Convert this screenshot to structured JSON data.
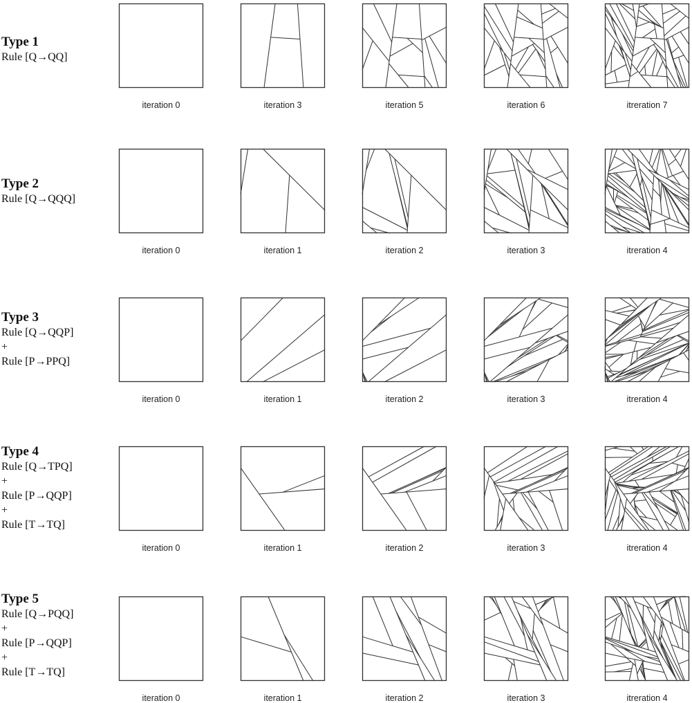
{
  "figure": {
    "rows": [
      {
        "title": "Type 1",
        "rules": [
          "Rule [Q→QQ]"
        ],
        "captions": [
          "iteration 0",
          "iteration 3",
          "iteration 5",
          "iteration 6",
          "itreration 7"
        ],
        "densities": [
          0,
          3,
          5,
          6,
          7
        ]
      },
      {
        "title": "Type 2",
        "rules": [
          "Rule [Q→QQQ]"
        ],
        "captions": [
          "iteration 0",
          "iteration 1",
          "iteration 2",
          "iteration 3",
          "itreration 4"
        ],
        "densities": [
          0,
          1,
          2,
          3,
          4
        ]
      },
      {
        "title": "Type 3",
        "rules": [
          "Rule [Q→QQP]",
          "+",
          "Rule [P→PPQ]"
        ],
        "captions": [
          "iteration 0",
          "iteration 1",
          "iteration 2",
          "iteration 3",
          "itreration 4"
        ],
        "densities": [
          0,
          1,
          2,
          3,
          4
        ]
      },
      {
        "title": "Type 4",
        "rules": [
          "Rule [Q→TPQ]",
          "+",
          "Rule [P→QQP]",
          "+",
          "Rule [T→TQ]"
        ],
        "captions": [
          "iteration 0",
          "iteration 1",
          "iteration 2",
          "iteration 3",
          "itreration 4"
        ],
        "densities": [
          0,
          1,
          2,
          3,
          4
        ]
      },
      {
        "title": "Type 5",
        "rules": [
          "Rule [Q→PQQ]",
          "+",
          "Rule [P→QQP]",
          "+",
          "Rule [T→TQ]"
        ],
        "captions": [
          "iteration 0",
          "iteration 1",
          "iteration 2",
          "iteration 3",
          "itreration 4"
        ],
        "densities": [
          0,
          1,
          2,
          3,
          4
        ]
      }
    ],
    "stroke_color": "#333333"
  }
}
